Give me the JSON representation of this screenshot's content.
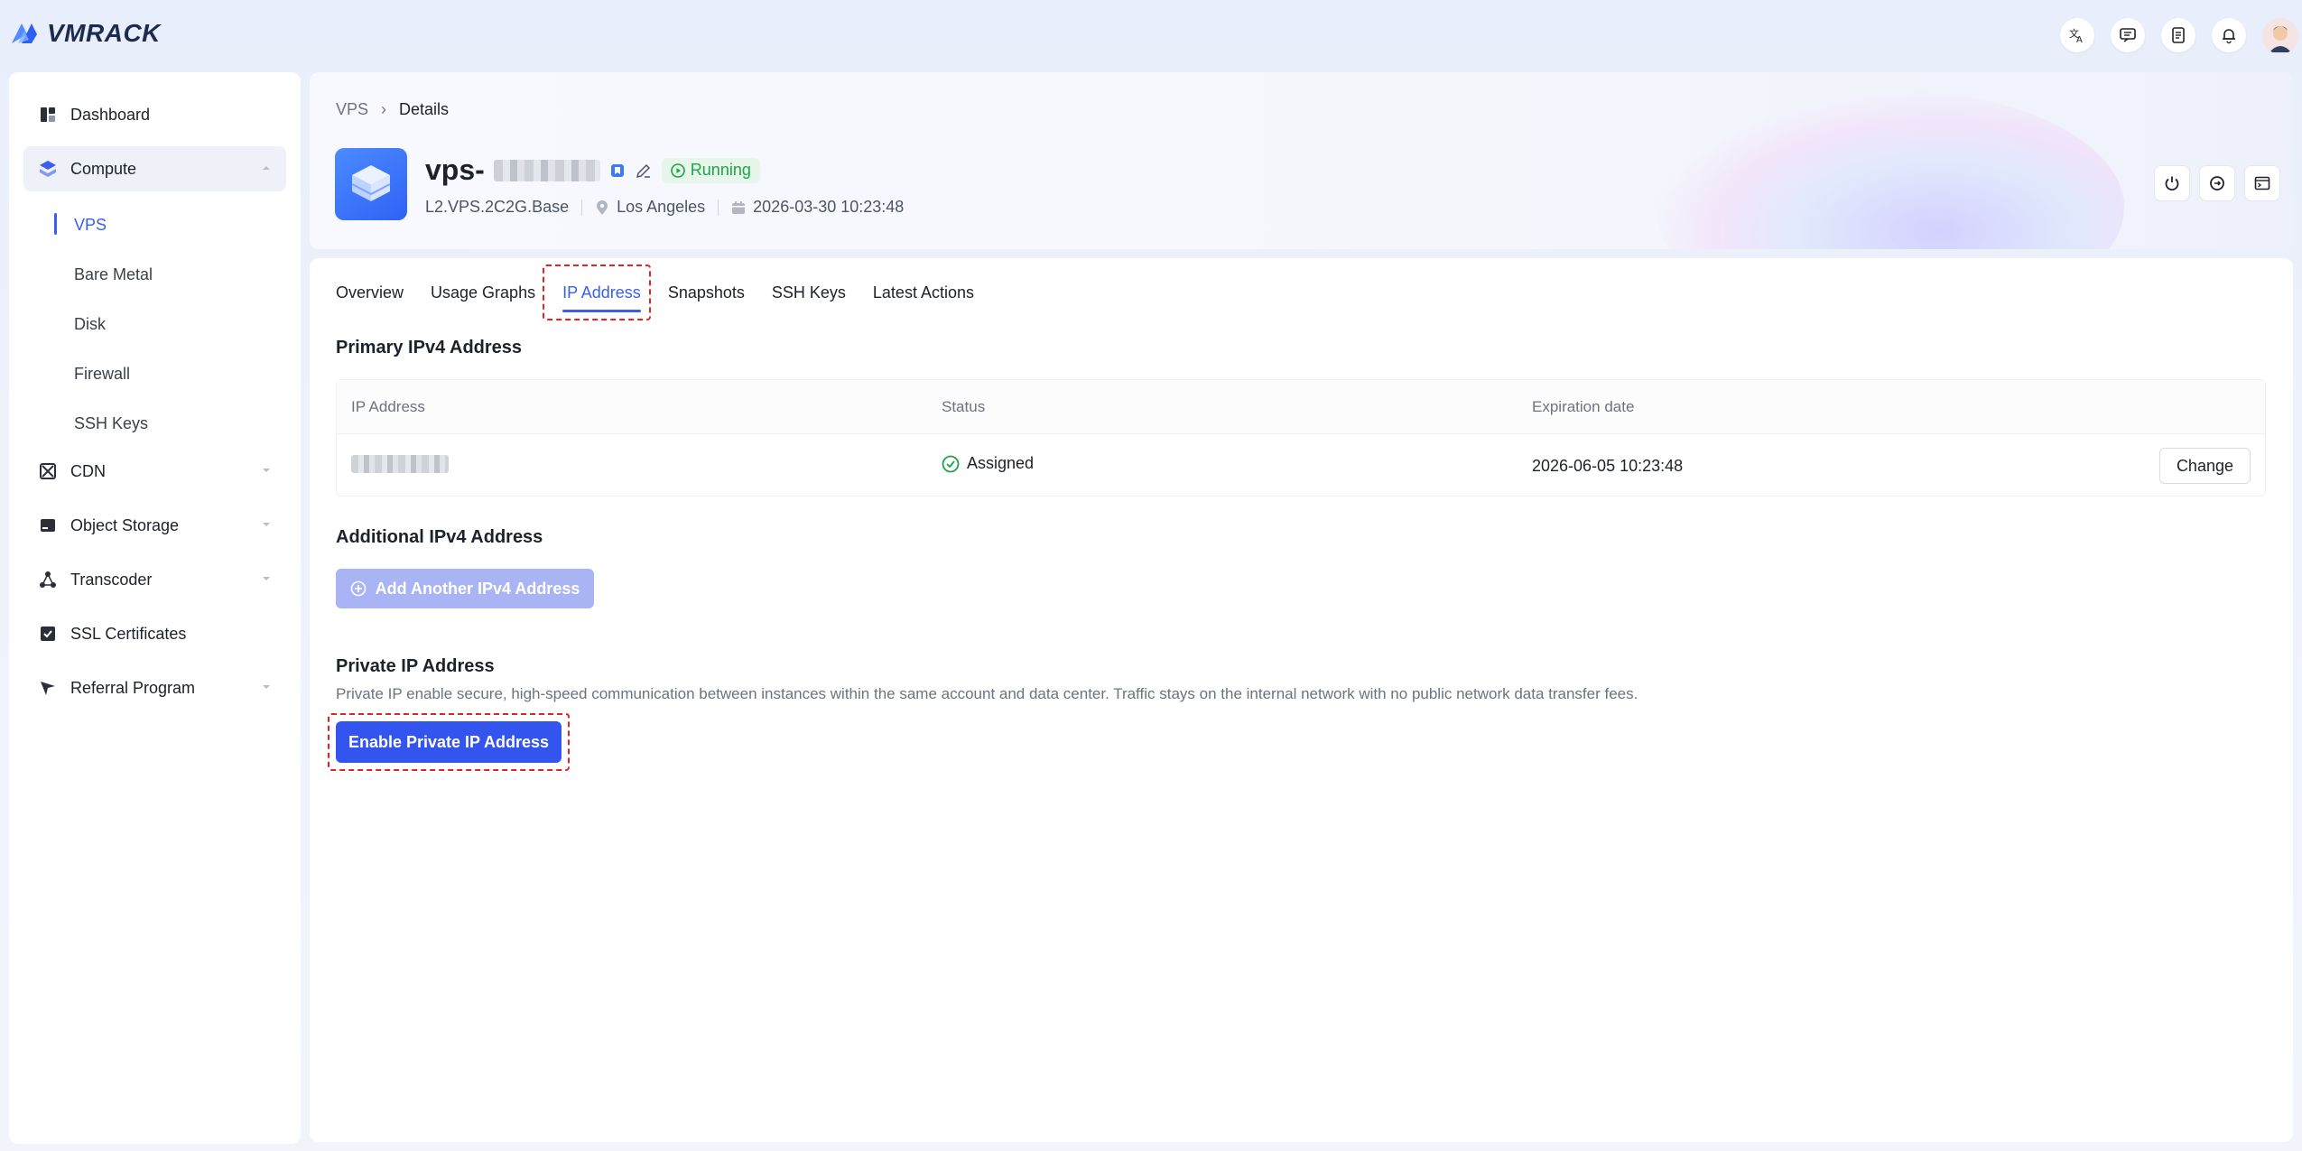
{
  "brand": {
    "name": "VMRACK",
    "color": "#3a5ef0"
  },
  "topbar": {
    "icons": [
      "translate-icon",
      "chat-icon",
      "document-icon",
      "bell-icon",
      "user-avatar"
    ]
  },
  "sidebar": {
    "items": [
      {
        "label": "Dashboard",
        "icon": "dashboard-icon"
      },
      {
        "label": "Compute",
        "icon": "compute-icon",
        "expanded": true
      },
      {
        "label": "CDN",
        "icon": "cdn-icon"
      },
      {
        "label": "Object Storage",
        "icon": "storage-icon"
      },
      {
        "label": "Transcoder",
        "icon": "transcoder-icon"
      },
      {
        "label": "SSL Certificates",
        "icon": "certificate-icon"
      },
      {
        "label": "Referral Program",
        "icon": "referral-icon"
      }
    ],
    "compute_sub": [
      {
        "label": "VPS",
        "active": true
      },
      {
        "label": "Bare Metal"
      },
      {
        "label": "Disk"
      },
      {
        "label": "Firewall"
      },
      {
        "label": "SSH Keys"
      }
    ]
  },
  "breadcrumb": {
    "parent": "VPS",
    "separator": "›",
    "current": "Details"
  },
  "instance": {
    "name_prefix": "vps-",
    "status": "Running",
    "plan": "L2.VPS.2C2G.Base",
    "location": "Los Angeles",
    "created": "2026-03-30 10:23:48"
  },
  "tabs": [
    "Overview",
    "Usage Graphs",
    "IP Address",
    "Snapshots",
    "SSH Keys",
    "Latest Actions"
  ],
  "active_tab": "IP Address",
  "primary": {
    "title": "Primary IPv4 Address",
    "columns": [
      "IP Address",
      "Status",
      "Expiration date"
    ],
    "row": {
      "status": "Assigned",
      "expiration": "2026-06-05 10:23:48",
      "action": "Change"
    }
  },
  "additional": {
    "title": "Additional IPv4 Address",
    "button": "Add Another IPv4 Address"
  },
  "private": {
    "title": "Private IP Address",
    "description": "Private IP enable secure, high-speed communication between instances within the same account and data center. Traffic stays on the internal network with no public network data transfer fees.",
    "button": "Enable Private IP Address"
  }
}
